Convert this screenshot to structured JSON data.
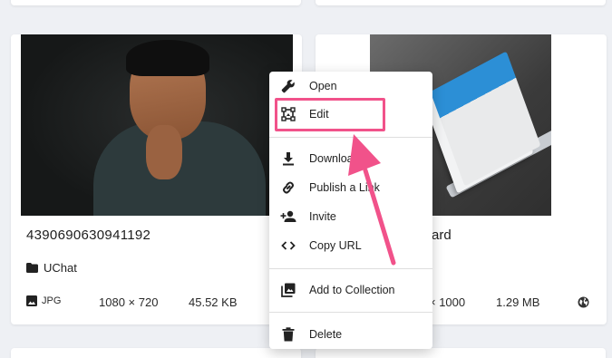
{
  "cards": {
    "left": {
      "title": "4390690630941192",
      "folder": "UChat",
      "type": "JPG",
      "dimensions": "1080 × 720",
      "size": "45.52 KB"
    },
    "right": {
      "title_partial": "s-card",
      "dimensions_partial": "× 1000",
      "size": "1.29 MB"
    }
  },
  "context_menu": {
    "items": [
      {
        "label": "Open",
        "icon": "wrench-icon"
      },
      {
        "label": "Edit",
        "icon": "crop-edit-icon"
      },
      {
        "label": "Download",
        "icon": "download-icon"
      },
      {
        "label": "Publish a Link",
        "icon": "link-icon"
      },
      {
        "label": "Invite",
        "icon": "person-add-icon"
      },
      {
        "label": "Copy URL",
        "icon": "code-icon"
      },
      {
        "label": "Add to Collection",
        "icon": "collection-icon"
      },
      {
        "label": "Delete",
        "icon": "trash-icon"
      }
    ]
  },
  "colors": {
    "highlight": "#f1528a",
    "background": "#eef0f4"
  }
}
